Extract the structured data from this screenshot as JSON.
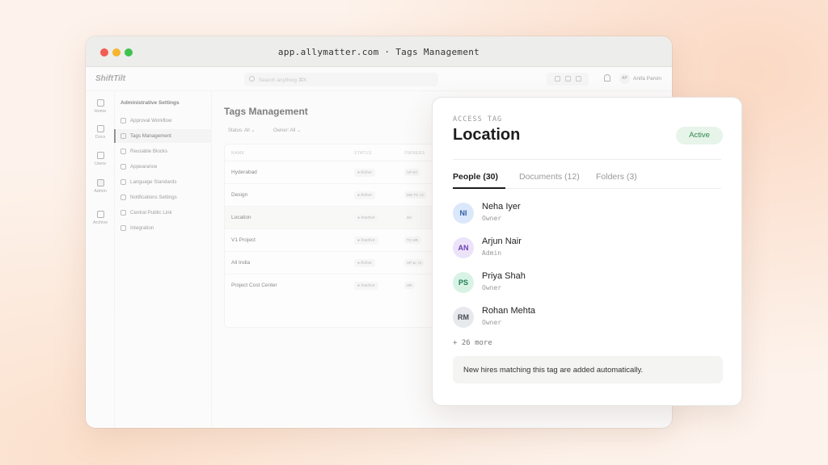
{
  "window": {
    "url": "app.allymatter.com · Tags Management"
  },
  "app": {
    "logo": "ShiftTilt",
    "search_placeholder": "Search anything   ⌘K",
    "user_initials": "AP",
    "user_name": "Anifa Parvin",
    "rail": [
      {
        "label": "Home",
        "icon": "home-icon"
      },
      {
        "label": "Docs",
        "icon": "docs-icon"
      },
      {
        "label": "Users",
        "icon": "users-icon"
      },
      {
        "label": "Admin",
        "icon": "admin-icon"
      },
      {
        "label": "Archive",
        "icon": "archive-icon"
      }
    ],
    "sidenav": {
      "header": "Administrative Settings",
      "items": [
        "Approval Workflow",
        "Tags Management",
        "Reusable Blocks",
        "Appearance",
        "Language Standards",
        "Notifications Settings",
        "Central Public Link",
        "Integration"
      ]
    },
    "main": {
      "title": "Tags Management",
      "filters": {
        "status": "Status: All",
        "owner": "Owner: All"
      },
      "columns": [
        "NAME",
        "STATUS",
        "OWNERS"
      ],
      "rows": [
        {
          "name": "Hyderabad",
          "status": "Active",
          "owners": "AP SV"
        },
        {
          "name": "Design",
          "status": "Active",
          "owners": "MG TC +2"
        },
        {
          "name": "Location",
          "status": "Inactive",
          "owners": "SV"
        },
        {
          "name": "V1 Project",
          "status": "Inactive",
          "owners": "TC HR"
        },
        {
          "name": "All India",
          "status": "Active",
          "owners": "AP JL +1"
        },
        {
          "name": "Project Cost Center",
          "status": "Inactive",
          "owners": "HR"
        }
      ]
    }
  },
  "card": {
    "eyebrow": "ACCESS TAG",
    "title": "Location",
    "status": "Active",
    "tabs": [
      "People (30)",
      "Documents (12)",
      "Folders (3)"
    ],
    "people": [
      {
        "initials": "NI",
        "name": "Neha Iyer",
        "role": "Owner",
        "bg": "#dbe8fb",
        "fg": "#2f5fa8"
      },
      {
        "initials": "AN",
        "name": "Arjun Nair",
        "role": "Admin",
        "bg": "#ece3fa",
        "fg": "#6a3fb0"
      },
      {
        "initials": "PS",
        "name": "Priya Shah",
        "role": "Owner",
        "bg": "#d8f3e6",
        "fg": "#1f7d52"
      },
      {
        "initials": "RM",
        "name": "Rohan Mehta",
        "role": "Owner",
        "bg": "#e8e9ec",
        "fg": "#444a55"
      }
    ],
    "more": "+ 26 more",
    "note": "New hires matching this tag are added automatically.",
    "colors": {
      "active_bg": "#e7f4ea",
      "active_fg": "#2f8a4c"
    }
  }
}
